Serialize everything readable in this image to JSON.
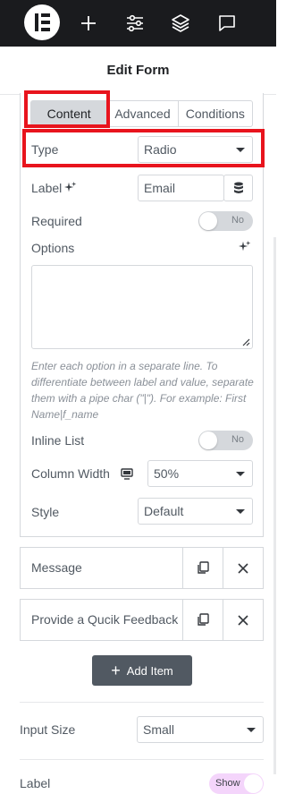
{
  "header": {
    "title": "Edit Form"
  },
  "topbar": {
    "icons": [
      "elementor-logo",
      "plus-icon",
      "sliders-icon",
      "layers-icon",
      "chat-icon"
    ]
  },
  "tabs": [
    {
      "label": "Content",
      "active": true
    },
    {
      "label": "Advanced",
      "active": false
    },
    {
      "label": "Conditions",
      "active": false
    }
  ],
  "field": {
    "type_label": "Type",
    "type_value": "Radio",
    "label_label": "Label",
    "label_value": "Email",
    "required_label": "Required",
    "required_toggle": "No",
    "options_label": "Options",
    "options_value": "",
    "options_help": "Enter each option in a separate line. To differentiate between label and value, separate them with a pipe char (\"|\"). For example: First Name|f_name",
    "inline_list_label": "Inline List",
    "inline_list_toggle": "No",
    "column_width_label": "Column Width",
    "column_width_value": "50%",
    "style_label": "Style",
    "style_value": "Default"
  },
  "items": [
    {
      "label": "Message"
    },
    {
      "label": "Provide a Qucik Feedback"
    }
  ],
  "add_item_label": "Add Item",
  "input_size": {
    "label": "Input Size",
    "value": "Small"
  },
  "label_setting": {
    "label": "Label",
    "toggle": "Show"
  },
  "colors": {
    "accent_red": "#e8141d",
    "topbar": "#1a1b1e",
    "button": "#515962",
    "show_toggle": "#f4d5fb"
  }
}
